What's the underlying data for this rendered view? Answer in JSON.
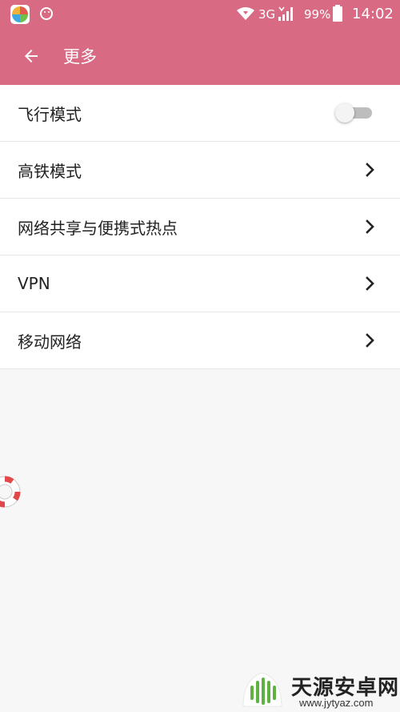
{
  "status_bar": {
    "network_type": "3G",
    "battery_percent": "99%",
    "time": "14:02",
    "icons": [
      "app-icon",
      "smiley-icon",
      "wifi-icon",
      "signal-icon",
      "battery-icon"
    ]
  },
  "app_bar": {
    "title": "更多",
    "back_icon": "arrow-left-icon",
    "background_color": "#d96a84"
  },
  "settings": {
    "items": [
      {
        "label": "飞行模式",
        "control": "toggle",
        "toggle_on": false
      },
      {
        "label": "高铁模式",
        "control": "chevron"
      },
      {
        "label": "网络共享与便携式热点",
        "control": "chevron"
      },
      {
        "label": "VPN",
        "control": "chevron"
      },
      {
        "label": "移动网络",
        "control": "chevron"
      }
    ]
  },
  "overlay": {
    "floating_icon": "lifebuoy-icon"
  },
  "watermark": {
    "title": "天源安卓网",
    "url": "www.jytyaz.com"
  }
}
